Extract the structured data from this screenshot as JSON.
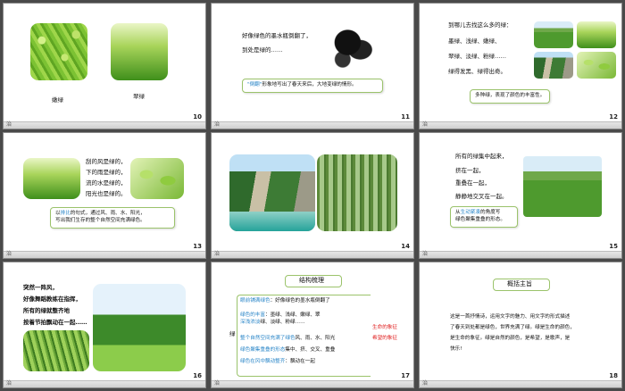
{
  "logo_char": "治",
  "slides": {
    "s10": {
      "num": "10",
      "cap1": "嫩绿",
      "cap2": "翠绿"
    },
    "s11": {
      "num": "11",
      "line1": "好像绿色的墨水瓶倒翻了，",
      "line2": "到处是绿的……",
      "callout_hl": "\"倒翻\"",
      "callout_rest": "形象地写出了春天来后，大地变绿的情形。"
    },
    "s12": {
      "num": "12",
      "line1": "到哪儿去找这么多的绿：",
      "line2": "墨绿、浅绿、嫩绿、",
      "line3": "翠绿、淡绿、粉绿……",
      "line4": "绿得发黑、绿得出奇。",
      "callout": "多种绿，表现了颜色的丰富性。"
    },
    "s13": {
      "num": "13",
      "line1": "刮的风是绿的，",
      "line2": "下的雨是绿的，",
      "line3": "流的水是绿的，",
      "line4": "阳光也是绿的。",
      "callout_a": "以",
      "callout_hl": "排比",
      "callout_b": "的句式，通过风、雨、水、阳光，",
      "callout_line2": "写出我们生存的整个自然空间充满绿色。"
    },
    "s14": {
      "num": "14"
    },
    "s15": {
      "num": "15",
      "line1": "所有的绿集中起来，",
      "line2": "挤在一起，",
      "line3": "重叠在一起，",
      "line4": "静静地交叉在一起。",
      "callout_a": "从",
      "callout_hl": "生动紧凑",
      "callout_b": "的角度写",
      "callout_line2": "绿色聚集重叠的形态。"
    },
    "s16": {
      "num": "16",
      "line1": "突然一阵风，",
      "line2": "好像舞蹈教练在指挥，",
      "line3": "所有的绿就整齐地",
      "line4": "按着节拍飘动在一起……"
    },
    "s17": {
      "num": "17",
      "title": "结构梳理",
      "left": "绿",
      "r1_hl": "眼前铺满绿色",
      "r1": "：好像绿色的墨水瓶倒翻了",
      "r2_hl": "绿色的丰富",
      "r2": "：墨绿、浅绿、嫩绿、翠",
      "r2b_hl": "深浅浓淡",
      "r2b": "绿、淡绿、粉绿……",
      "r3_hl": "整个自然空间充满了绿色",
      "r3": "风、雨、水、阳光",
      "r4_hl": "绿色聚集重叠的形态",
      "r4": "集中、挤、交叉、重叠",
      "r5_hl": "绿色在风中飘动整齐",
      "r5": "：飘动在一起",
      "side1": "生命的象征",
      "side2": "希望的象征"
    },
    "s18": {
      "num": "18",
      "title": "概括主旨",
      "p1": "这是一首抒情诗，运用文字的魅力、用文字的形式描述",
      "p2": "了春天到处都是绿色，世界充满了绿。绿是生命的颜色，",
      "p3": "是生命的象征。绿是自然的颜色，是希望，是歌声，是",
      "p4": "快乐!"
    }
  }
}
